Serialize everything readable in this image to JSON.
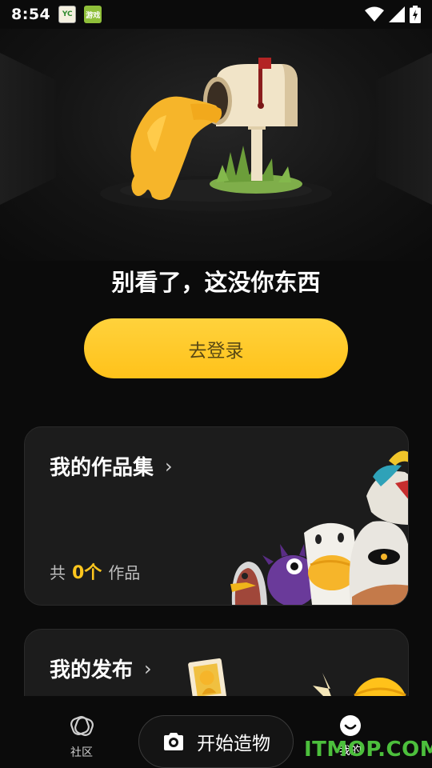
{
  "status_bar": {
    "time": "8:54",
    "app_icon_1": "YC",
    "app_icon_2": "游戏",
    "icons": [
      "wifi-icon",
      "signal-icon",
      "battery-icon"
    ]
  },
  "hero": {
    "illustration": "character-peeking-into-mailbox",
    "empty_title": "别看了，这没你东西"
  },
  "login_button": {
    "label": "去登录"
  },
  "works_card": {
    "title": "我的作品集",
    "chevron": "›",
    "count_prefix": "共",
    "count_value": "0个",
    "count_suffix": "作品"
  },
  "posts_card": {
    "title": "我的发布",
    "chevron": "›"
  },
  "bottom_nav": {
    "community_label": "社区",
    "create_label": "开始造物",
    "mine_label": "我的"
  },
  "watermark": "ITMOP.COM",
  "colors": {
    "accent": "#ffc21a",
    "background": "#0b0b0b",
    "card": "#1c1c1c",
    "watermark": "#4cbf3c"
  }
}
